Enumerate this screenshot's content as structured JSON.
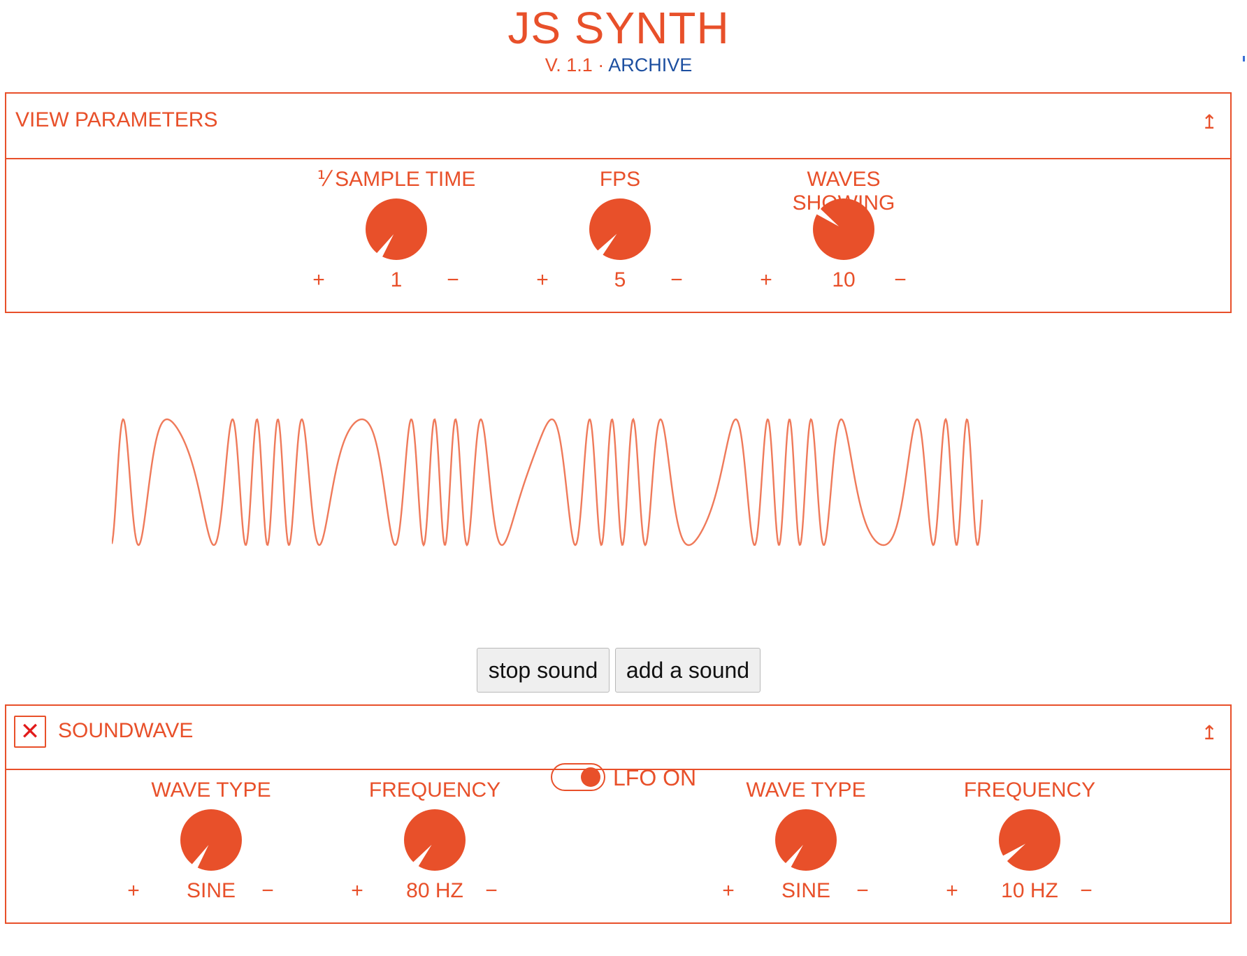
{
  "app": {
    "title": "JS SYNTH",
    "version": "V. 1.1",
    "separator": " · ",
    "archive_link": "ARCHIVE"
  },
  "colors": {
    "accent": "#e8502a",
    "link": "#1d4fa0",
    "close": "#e21b1b"
  },
  "view_parameters": {
    "title": "VIEW PARAMETERS",
    "collapse_icon": "↥",
    "knobs": [
      {
        "label": "⅟ SAMPLE TIME",
        "value": "1",
        "plus": "+",
        "minus": "−",
        "angle": 208
      },
      {
        "label": "FPS",
        "value": "5",
        "plus": "+",
        "minus": "−",
        "angle": 215
      },
      {
        "label": "WAVES SHOWING",
        "value": "10",
        "plus": "+",
        "minus": "−",
        "angle": 300
      }
    ]
  },
  "buttons": {
    "stop": "stop sound",
    "add": "add a sound"
  },
  "soundwave": {
    "title": "SOUNDWAVE",
    "close_icon": "✕",
    "collapse_icon": "↥",
    "lfo_label": "LFO ON",
    "lfo_on": true,
    "knobs": [
      {
        "label": "WAVE TYPE",
        "value": "SINE",
        "plus": "+",
        "minus": "−",
        "angle": 207
      },
      {
        "label": "FREQUENCY",
        "value": "80 HZ",
        "plus": "+",
        "minus": "−",
        "angle": 213
      },
      {
        "label": "WAVE TYPE",
        "value": "SINE",
        "plus": "+",
        "minus": "−",
        "angle": 210
      },
      {
        "label": "FREQUENCY",
        "value": "10 HZ",
        "plus": "+",
        "minus": "−",
        "angle": 228
      }
    ]
  }
}
